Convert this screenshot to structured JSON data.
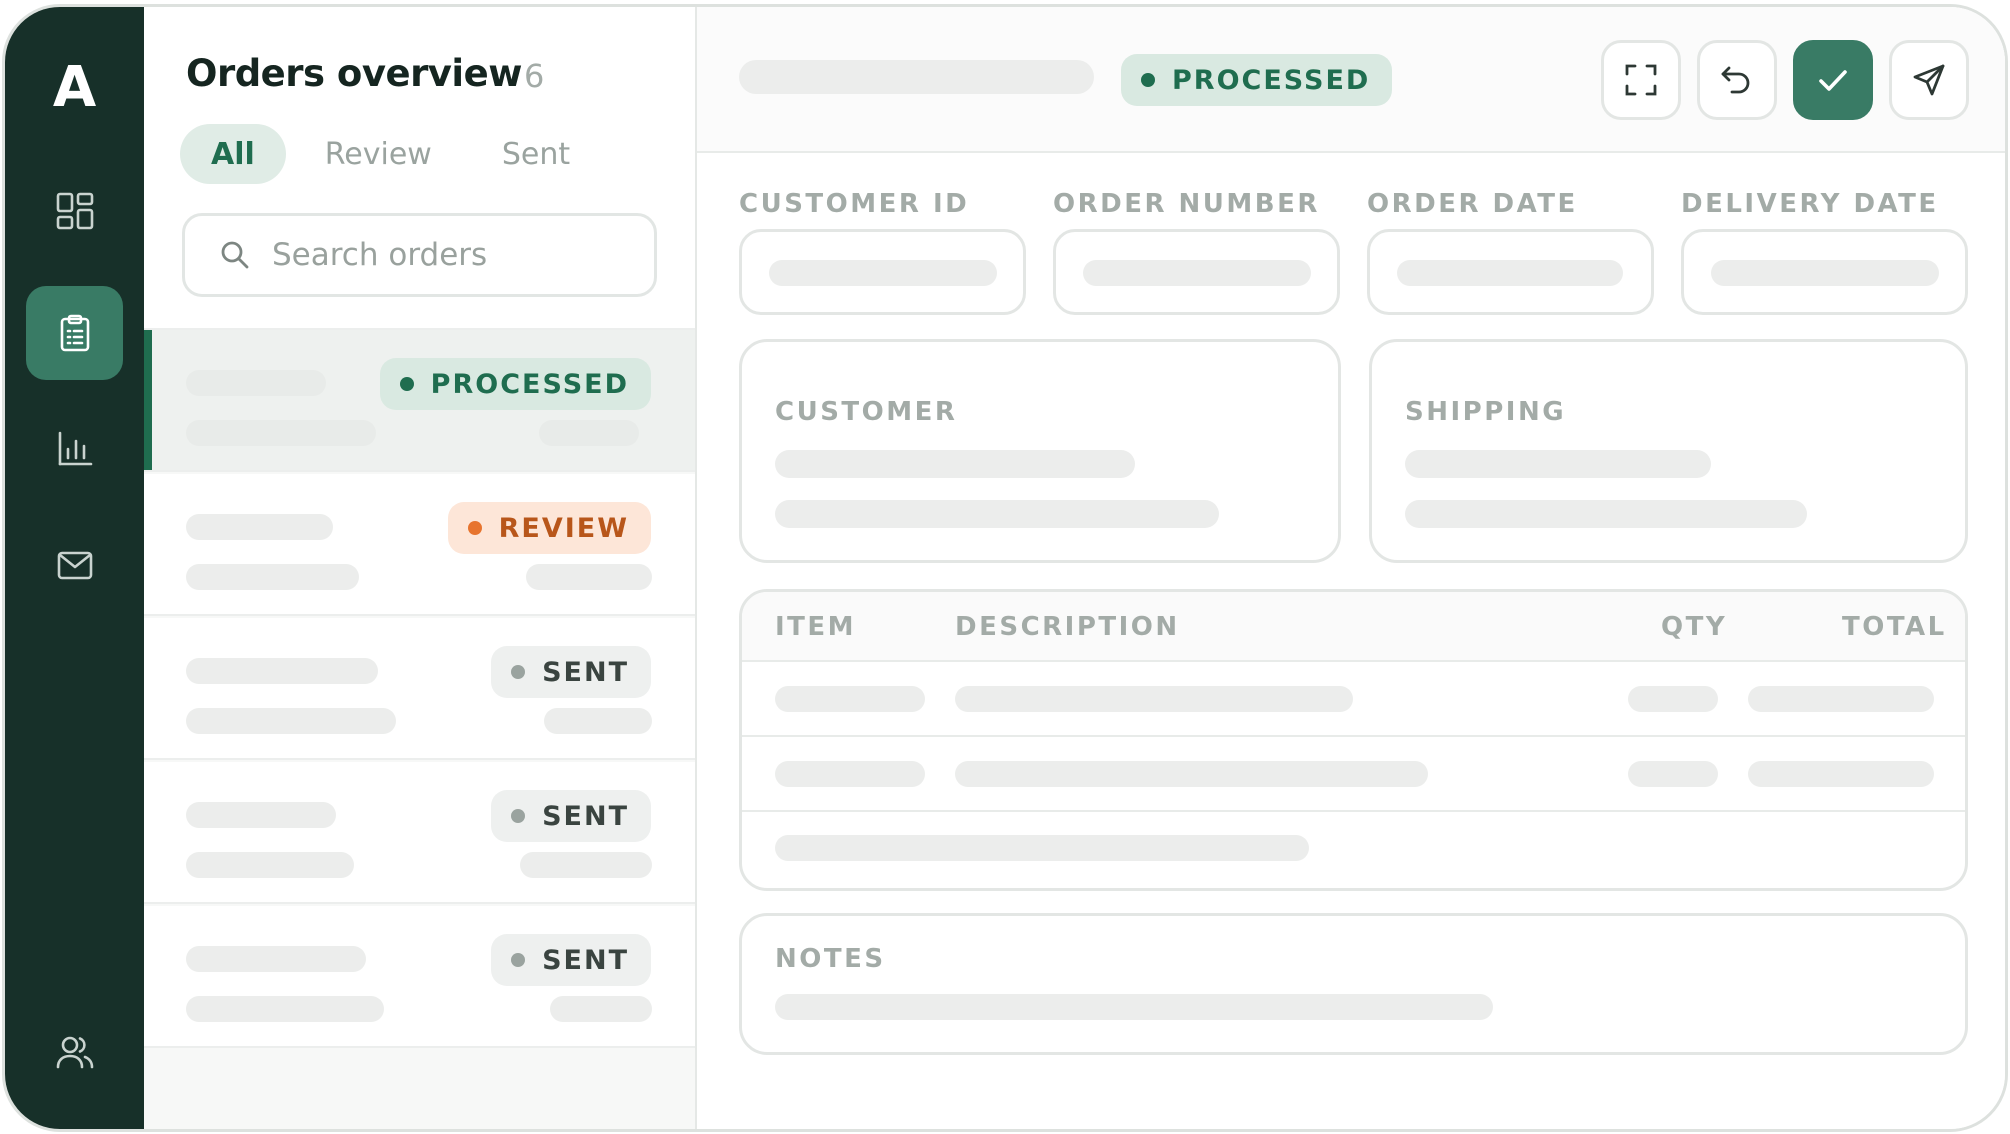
{
  "app": {
    "logo": "A"
  },
  "colors": {
    "rail": "#173029",
    "accent": "#397b65",
    "processed": "#1f6d4f",
    "review": "#b8561a",
    "sent": "#3a4440"
  },
  "rail": {
    "items": [
      {
        "icon": "dashboard-grid-icon",
        "active": false
      },
      {
        "icon": "clipboard-list-icon",
        "active": true
      },
      {
        "icon": "bar-chart-icon",
        "active": false
      },
      {
        "icon": "mail-icon",
        "active": false
      },
      {
        "icon": "users-icon",
        "active": false
      }
    ]
  },
  "list": {
    "title": "Orders overview",
    "count": "6",
    "tabs": [
      {
        "label": "All",
        "active": true
      },
      {
        "label": "Review",
        "active": false
      },
      {
        "label": "Sent",
        "active": false
      }
    ],
    "search": {
      "placeholder": "Search orders",
      "value": "",
      "icon": "search-icon"
    },
    "orders": [
      {
        "status": "PROCESSED",
        "kind": "processed",
        "selected": true
      },
      {
        "status": "REVIEW",
        "kind": "review",
        "selected": false
      },
      {
        "status": "SENT",
        "kind": "sent",
        "selected": false
      },
      {
        "status": "SENT",
        "kind": "sent",
        "selected": false
      },
      {
        "status": "SENT",
        "kind": "sent",
        "selected": false
      }
    ]
  },
  "detail": {
    "status": "PROCESSED",
    "toolbar": {
      "expand_icon": "expand-icon",
      "undo_icon": "undo-icon",
      "approve_icon": "check-icon",
      "send_icon": "send-icon"
    },
    "fields": [
      {
        "label": "CUSTOMER ID"
      },
      {
        "label": "ORDER NUMBER"
      },
      {
        "label": "ORDER DATE"
      },
      {
        "label": "DELIVERY DATE"
      }
    ],
    "customer_title": "CUSTOMER",
    "shipping_title": "SHIPPING",
    "table": {
      "columns": [
        "ITEM",
        "DESCRIPTION",
        "QTY",
        "TOTAL"
      ]
    },
    "notes_title": "NOTES"
  }
}
